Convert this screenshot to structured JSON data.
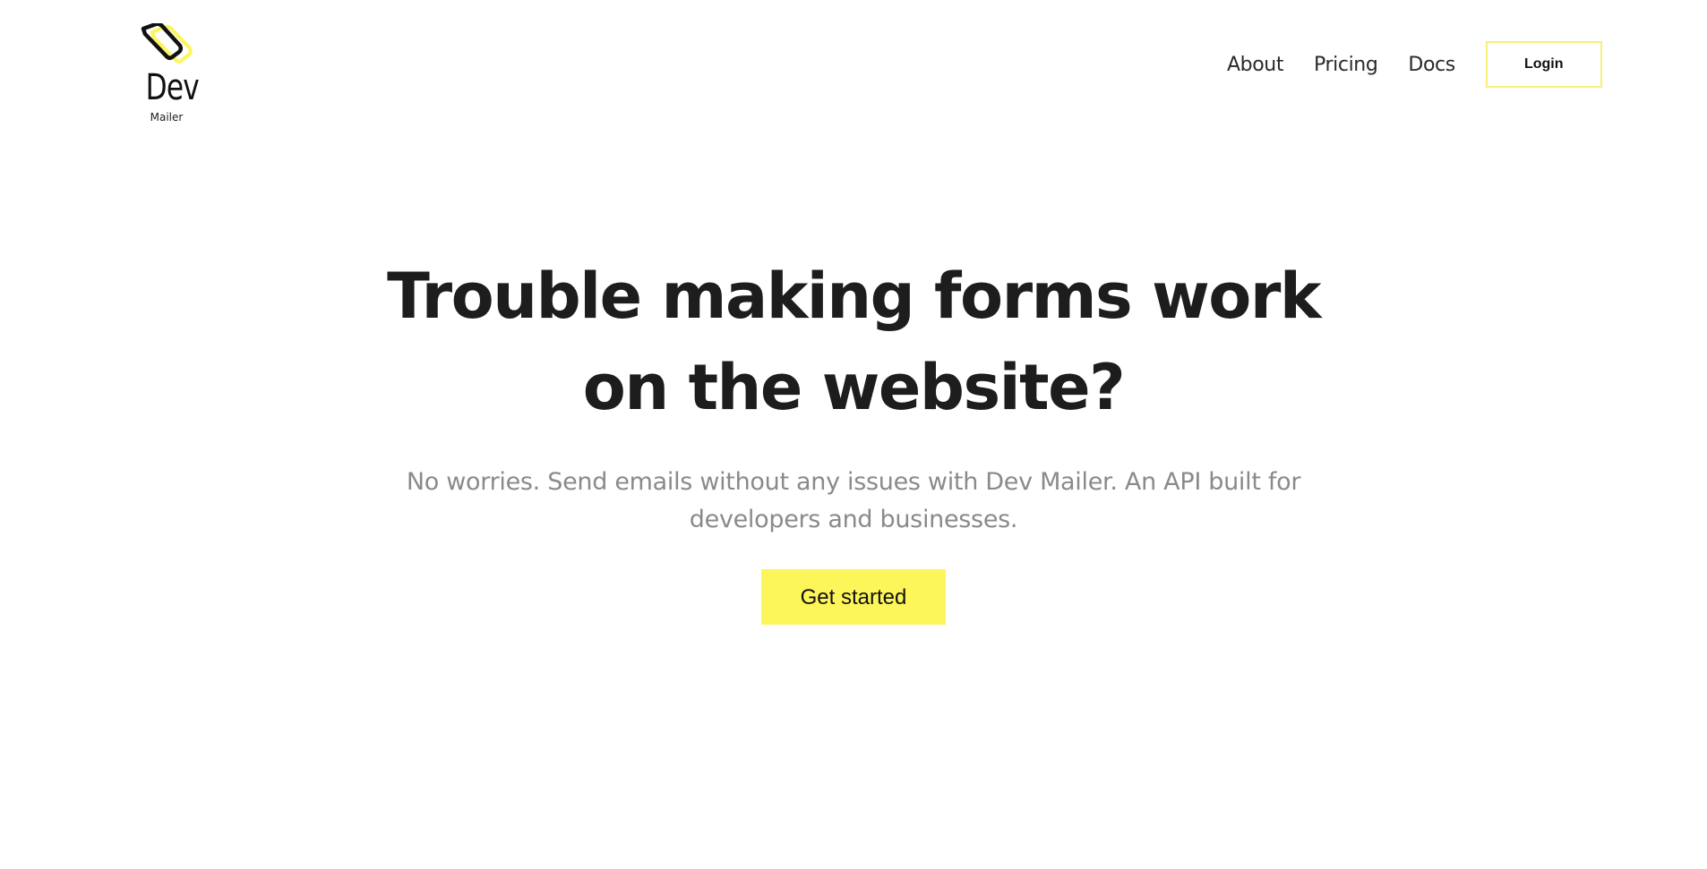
{
  "brand": {
    "name": "Dev",
    "tagline": "Mailer",
    "colors": {
      "accent": "#fdf65a",
      "accent_border": "#f7f07a",
      "text_dark": "#1d1d1d",
      "text_muted": "#8a8a8a"
    }
  },
  "nav": {
    "links": [
      {
        "label": "About"
      },
      {
        "label": "Pricing"
      },
      {
        "label": "Docs"
      }
    ],
    "login_label": "Login"
  },
  "hero": {
    "title": "Trouble making forms work on the website?",
    "subtitle": "No worries. Send emails without any issues with Dev Mailer. An API built for developers and businesses.",
    "cta_label": "Get started"
  }
}
